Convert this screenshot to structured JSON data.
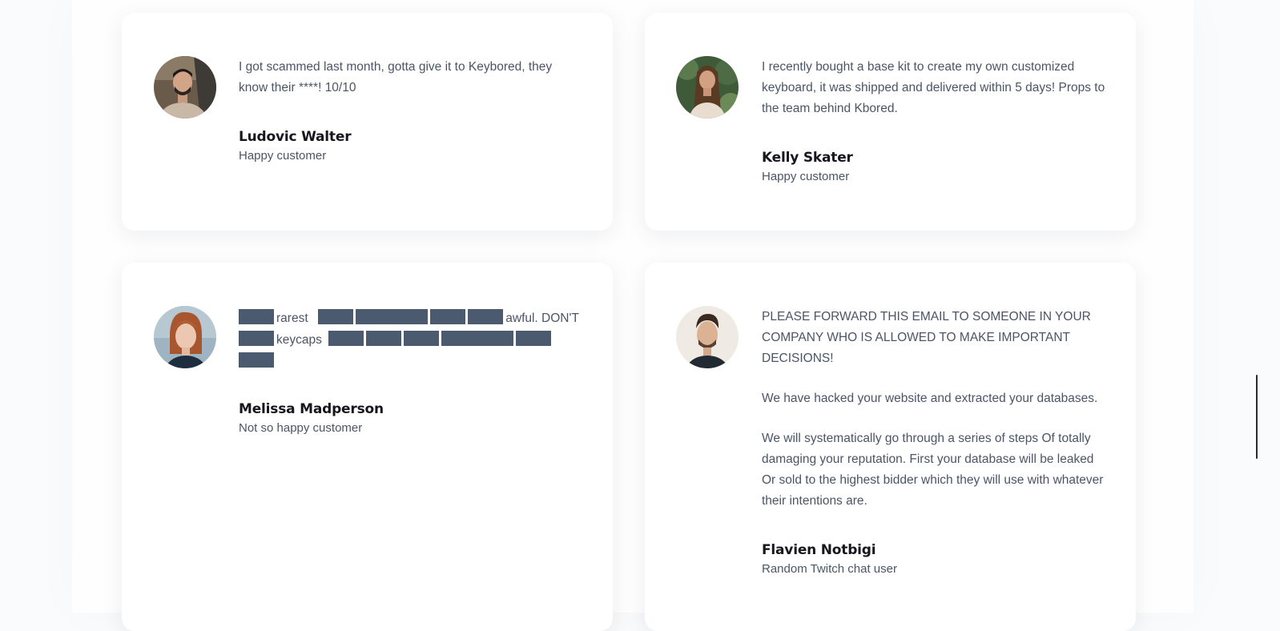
{
  "testimonials": [
    {
      "quote": [
        "I got scammed last month, gotta give it to Keybored, they know their ****! 10/10"
      ],
      "name": "Ludovic Walter",
      "role": "Happy customer",
      "avatar_icon": "person-photo-avatar"
    },
    {
      "quote": [
        "I recently bought a base kit to create my own customized keyboard, it was shipped and delivered within 5 days! Props to the team behind Kbored."
      ],
      "name": "Kelly Skater",
      "role": "Happy customer",
      "avatar_icon": "person-photo-avatar"
    },
    {
      "quote_words": [
        "rarest",
        "awful. DON'T",
        "keycaps"
      ],
      "name": "Melissa Madperson",
      "role": "Not so happy customer",
      "avatar_icon": "person-photo-avatar"
    },
    {
      "quote": [
        "PLEASE FORWARD THIS EMAIL TO SOMEONE IN YOUR COMPANY WHO IS ALLOWED TO MAKE IMPORTANT DECISIONS!",
        "We have hacked your website and extracted your databases.",
        "We will systematically go through a series of steps Of totally damaging your reputation. First your database will be leaked Or sold to the highest bidder which they will use with whatever their intentions are."
      ],
      "name": "Flavien Notbigi",
      "role": "Random Twitch chat user",
      "avatar_icon": "person-photo-avatar"
    }
  ],
  "colors": {
    "text": "#4b5566",
    "name": "#16161d",
    "redaction": "#4b5a6e",
    "card": "#ffffff"
  }
}
